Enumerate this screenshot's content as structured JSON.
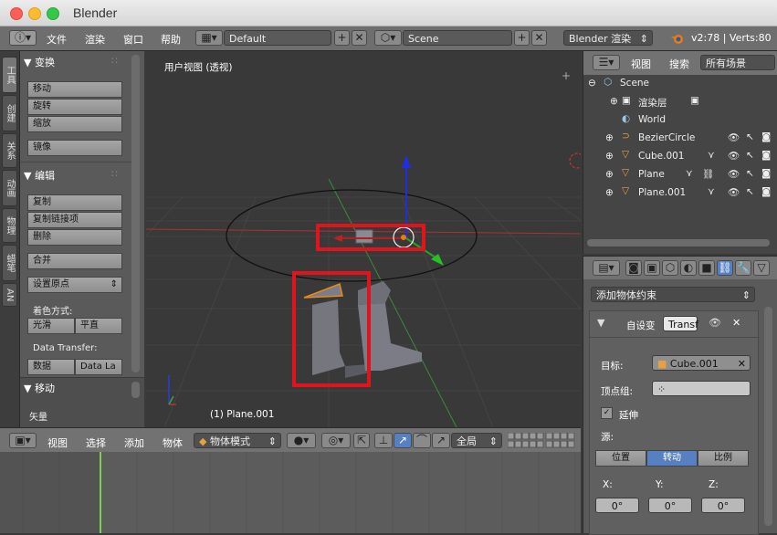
{
  "window": {
    "title": "Blender"
  },
  "info_header": {
    "menus": [
      "文件",
      "渲染",
      "窗口",
      "帮助"
    ],
    "layout": "Default",
    "scene": "Scene",
    "engine": "Blender 渲染",
    "stats": "v2:78 | Verts:80"
  },
  "tool_tabs": [
    "工具",
    "创建",
    "关系",
    "动画",
    "物理",
    "蜡笔",
    "AN"
  ],
  "tool_shelf": {
    "transform_header": "▼ 变换",
    "transform_buttons": [
      "移动",
      "旋转",
      "缩放"
    ],
    "mirror": "镜像",
    "edit_header": "▼ 编辑",
    "edit_buttons": [
      "复制",
      "复制链接项",
      "删除"
    ],
    "join": "合并",
    "set_origin": "设置原点",
    "shading_label": "着色方式:",
    "smooth": "光滑",
    "flat": "平直",
    "data_transfer_label": "Data Transfer:",
    "data": "数据",
    "data_layers": "Data La",
    "move_header": "▼ 移动",
    "vector_label": "矢量"
  },
  "viewport": {
    "view_name": "用户视图 (透视)",
    "active_object": "(1) Plane.001"
  },
  "view3d_header": {
    "menus": [
      "视图",
      "选择",
      "添加",
      "物体"
    ],
    "mode": "物体模式",
    "orientation": "全局"
  },
  "outliner_header": {
    "menus": [
      "视图",
      "搜索"
    ],
    "filter": "所有场景"
  },
  "outliner": {
    "rows": [
      {
        "label": "Scene"
      },
      {
        "label": "渲染层"
      },
      {
        "label": "World"
      },
      {
        "label": "BezierCircle"
      },
      {
        "label": "Cube.001"
      },
      {
        "label": "Plane"
      },
      {
        "label": "Plane.001"
      }
    ]
  },
  "properties": {
    "add_constraint": "添加物体约束",
    "constraint_name": "自设变",
    "constraint_type": "Transf",
    "target_label": "目标:",
    "target_value": "Cube.001",
    "vertex_group_label": "顶点组:",
    "extrapolate": "延伸",
    "source_label": "源:",
    "tabs": [
      "位置",
      "转动",
      "比例"
    ],
    "active_tab_index": 1,
    "axis_labels": [
      "X:",
      "Y:",
      "Z:"
    ],
    "axis_values": [
      "0°",
      "0°",
      "0°"
    ]
  },
  "colors": {
    "accent_blue": "#5680c2",
    "highlight_red": "#e0141c",
    "x_axis": "#c03030",
    "y_axis": "#3aa63a",
    "z_axis": "#2a3ae0",
    "timeline_frame": "#7ad34a"
  }
}
